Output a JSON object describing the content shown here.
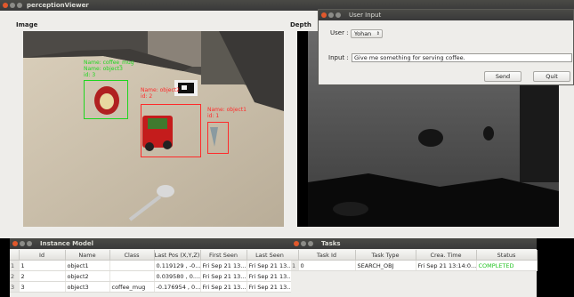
{
  "main_window": {
    "title": "perceptionViewer",
    "image_label": "Image",
    "depth_label": "Depth",
    "detections": [
      {
        "name_line": "Name: coffee_mug",
        "sub_line": "Name: object3",
        "id_line": "id: 3",
        "color": "#1fd61f"
      },
      {
        "name_line": "Name: object2",
        "sub_line": "",
        "id_line": "id: 2",
        "color": "#ff2a2a"
      },
      {
        "name_line": "Name: object1",
        "sub_line": "",
        "id_line": "id: 1",
        "color": "#ff2a2a"
      }
    ]
  },
  "user_input": {
    "title": "User Input",
    "user_label": "User :",
    "user_value": "Yohan",
    "input_label": "Input :",
    "input_value": "Give me something for serving coffee.",
    "send_label": "Send",
    "quit_label": "Quit"
  },
  "instance_model": {
    "title": "Instance Model",
    "columns": [
      "Id",
      "Name",
      "Class",
      "Last Pos (X,Y,Z)",
      "First Seen",
      "Last Seen"
    ],
    "rows": [
      {
        "rn": "1",
        "id": "1",
        "name": "object1",
        "cls": "",
        "pos": "0.119129 , -0...",
        "first": "Fri Sep 21 13...",
        "last": "Fri Sep 21 13..."
      },
      {
        "rn": "2",
        "id": "2",
        "name": "object2",
        "cls": "",
        "pos": "0.039580 , 0....",
        "first": "Fri Sep 21 13...",
        "last": "Fri Sep 21 13..."
      },
      {
        "rn": "3",
        "id": "3",
        "name": "object3",
        "cls": "coffee_mug",
        "pos": "-0.176954 , 0...",
        "first": "Fri Sep 21 13...",
        "last": "Fri Sep 21 13..."
      }
    ]
  },
  "tasks": {
    "title": "Tasks",
    "columns": [
      "Task Id",
      "Task Type",
      "Crea. Time",
      "Status"
    ],
    "rows": [
      {
        "rn": "1",
        "task_id": "0",
        "type": "SEARCH_OBJ",
        "time": "Fri Sep 21 13:14:0...",
        "status": "COMPLETED"
      }
    ],
    "status_color": "#1fc21f"
  }
}
